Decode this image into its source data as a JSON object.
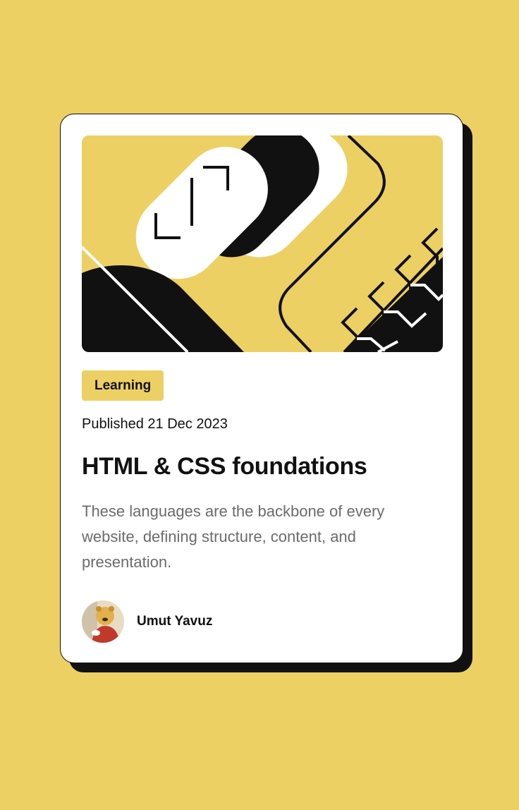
{
  "card": {
    "category": "Learning",
    "published": "Published 21 Dec 2023",
    "title": "HTML & CSS foundations",
    "description": "These languages are the backbone of every website, defining structure, content, and presentation.",
    "author": {
      "name": "Umut Yavuz",
      "avatar_icon": "avatar-portrait-icon"
    },
    "illustration_icon": "abstract-illustration-icon"
  },
  "colors": {
    "background": "#EDD064",
    "card": "#FFFFFF",
    "ink": "#111111",
    "muted_text": "#6B6B6B",
    "accent": "#EDD064"
  }
}
